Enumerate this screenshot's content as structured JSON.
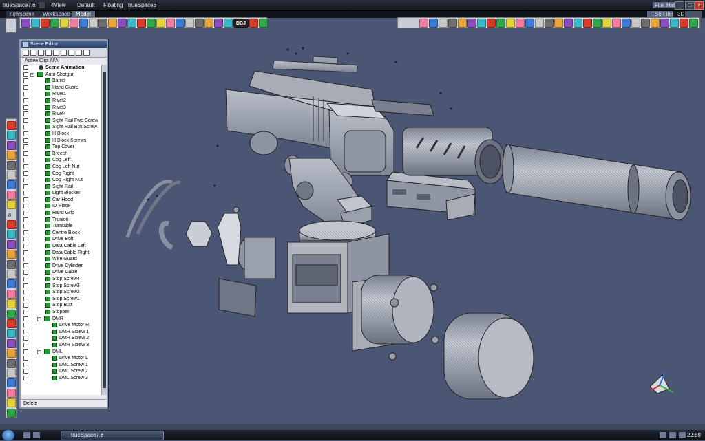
{
  "window": {
    "app_title": "trueSpace7.6",
    "view_label": "4View",
    "layout_default": "Default",
    "layout_floating": "Floating",
    "doc_title": "trueSpace6",
    "file_menu": "File",
    "help_menu": "Help",
    "ts_files": "TS6 Files",
    "mode_3d": "3D"
  },
  "tabs": [
    {
      "label": "newscene"
    },
    {
      "label": "Workspace"
    },
    {
      "label": "Model"
    }
  ],
  "toolbar": {
    "dbj_label": "DBJ"
  },
  "vertical_toolbar": {
    "zero_label": "0"
  },
  "scene_editor": {
    "title": "Scene Editor",
    "active_clip": "Active Clip: N/A",
    "status": "Delete",
    "items": [
      {
        "label": "Scene Animation",
        "level": 0,
        "kind": "anim"
      },
      {
        "label": "Auto Shotgun",
        "level": 0,
        "kind": "group"
      },
      {
        "label": "Barrel",
        "level": 1,
        "kind": "obj"
      },
      {
        "label": "Hand Guard",
        "level": 1,
        "kind": "obj"
      },
      {
        "label": "Rivet1",
        "level": 1,
        "kind": "obj"
      },
      {
        "label": "Rivet2",
        "level": 1,
        "kind": "obj"
      },
      {
        "label": "Rivet3",
        "level": 1,
        "kind": "obj"
      },
      {
        "label": "Rivet4",
        "level": 1,
        "kind": "obj"
      },
      {
        "label": "Sight Rail Fwd Screw",
        "level": 1,
        "kind": "obj"
      },
      {
        "label": "Sight Rail Bck Screw",
        "level": 1,
        "kind": "obj"
      },
      {
        "label": "H Block",
        "level": 1,
        "kind": "obj"
      },
      {
        "label": "H Block Screws",
        "level": 1,
        "kind": "obj"
      },
      {
        "label": "Top Cover",
        "level": 1,
        "kind": "obj"
      },
      {
        "label": "Breech",
        "level": 1,
        "kind": "obj"
      },
      {
        "label": "Cog Left",
        "level": 1,
        "kind": "obj"
      },
      {
        "label": "Cog Left Nut",
        "level": 1,
        "kind": "obj"
      },
      {
        "label": "Cog Right",
        "level": 1,
        "kind": "obj"
      },
      {
        "label": "Cog Right Nut",
        "level": 1,
        "kind": "obj"
      },
      {
        "label": "Sight Rail",
        "level": 1,
        "kind": "obj"
      },
      {
        "label": "Light Blocker",
        "level": 1,
        "kind": "obj"
      },
      {
        "label": "Car Hood",
        "level": 1,
        "kind": "obj"
      },
      {
        "label": "ID Plate",
        "level": 1,
        "kind": "obj"
      },
      {
        "label": "Hand Grip",
        "level": 1,
        "kind": "obj"
      },
      {
        "label": "Trunion",
        "level": 1,
        "kind": "obj"
      },
      {
        "label": "Turntable",
        "level": 1,
        "kind": "obj"
      },
      {
        "label": "Centre Block",
        "level": 1,
        "kind": "obj"
      },
      {
        "label": "Drive Bolt",
        "level": 1,
        "kind": "obj"
      },
      {
        "label": "Data Cable Left",
        "level": 1,
        "kind": "obj"
      },
      {
        "label": "Data Cable Right",
        "level": 1,
        "kind": "obj"
      },
      {
        "label": "Wire Guard",
        "level": 1,
        "kind": "obj"
      },
      {
        "label": "Drive Cylinder",
        "level": 1,
        "kind": "obj"
      },
      {
        "label": "Drive Cable",
        "level": 1,
        "kind": "obj"
      },
      {
        "label": "Stop Screw4",
        "level": 1,
        "kind": "obj"
      },
      {
        "label": "Stop Screw3",
        "level": 1,
        "kind": "obj"
      },
      {
        "label": "Stop Screw2",
        "level": 1,
        "kind": "obj"
      },
      {
        "label": "Stop Screw1",
        "level": 1,
        "kind": "obj"
      },
      {
        "label": "Stop Butt",
        "level": 1,
        "kind": "obj"
      },
      {
        "label": "Stopper",
        "level": 1,
        "kind": "obj"
      },
      {
        "label": "DMR",
        "level": 1,
        "kind": "group"
      },
      {
        "label": "Drive Motor R",
        "level": 2,
        "kind": "obj"
      },
      {
        "label": "DMR Screw 1",
        "level": 2,
        "kind": "obj"
      },
      {
        "label": "DMR Screw 2",
        "level": 2,
        "kind": "obj"
      },
      {
        "label": "DMR Screw 3",
        "level": 2,
        "kind": "obj"
      },
      {
        "label": "DML",
        "level": 1,
        "kind": "group"
      },
      {
        "label": "Drive Motor L",
        "level": 2,
        "kind": "obj"
      },
      {
        "label": "DML Screw 1",
        "level": 2,
        "kind": "obj"
      },
      {
        "label": "DML Screw 2",
        "level": 2,
        "kind": "obj"
      },
      {
        "label": "DML Screw 3",
        "level": 2,
        "kind": "obj"
      }
    ]
  },
  "taskbar": {
    "task_label": "trueSpace7.6",
    "clock": "22:59"
  },
  "colors": {
    "viewport_bg": "#4b5674",
    "model_fill": "#9aa0ac",
    "object_icon": "#1e9e2a"
  }
}
